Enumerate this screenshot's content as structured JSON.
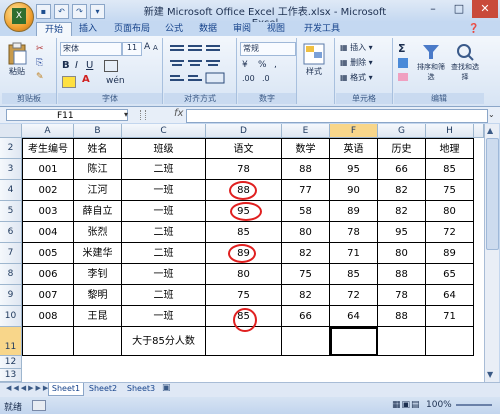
{
  "window": {
    "title": "新建 Microsoft Office Excel 工作表.xlsx - Microsoft Excel"
  },
  "tabs": [
    "开始",
    "插入",
    "页面布局",
    "公式",
    "数据",
    "审阅",
    "视图",
    "开发工具"
  ],
  "ribbon": {
    "clipboard": {
      "paste": "粘贴",
      "label": "剪贴板"
    },
    "font": {
      "name": "宋体",
      "size": "11",
      "label": "字体"
    },
    "alignment": {
      "label": "对齐方式"
    },
    "number": {
      "format": "常规",
      "label": "数字"
    },
    "styles": {
      "label": "样式",
      "button": "样式"
    },
    "cells": {
      "insert": "插入",
      "delete": "删除",
      "format": "格式",
      "label": "单元格"
    },
    "editing": {
      "sum": "Σ",
      "sort": "排序和筛选",
      "find": "查找和选择",
      "label": "编辑"
    }
  },
  "formula_bar": {
    "name_box": "F11",
    "fx": "fx",
    "value": ""
  },
  "columns": [
    "A",
    "B",
    "C",
    "D",
    "E",
    "F",
    "G",
    "H"
  ],
  "rows": [
    "2",
    "3",
    "4",
    "5",
    "6",
    "7",
    "8",
    "9",
    "10",
    "11",
    "12",
    "13"
  ],
  "table": {
    "headers": [
      "考生编号",
      "姓名",
      "班级",
      "语文",
      "数学",
      "英语",
      "历史",
      "地理"
    ],
    "data": [
      [
        "001",
        "陈江",
        "二班",
        "78",
        "88",
        "95",
        "66",
        "85"
      ],
      [
        "002",
        "江河",
        "一班",
        "88",
        "77",
        "90",
        "82",
        "75"
      ],
      [
        "003",
        "薛自立",
        "一班",
        "95",
        "58",
        "89",
        "82",
        "80"
      ],
      [
        "004",
        "张烈",
        "二班",
        "85",
        "80",
        "78",
        "95",
        "72"
      ],
      [
        "005",
        "米建华",
        "二班",
        "89",
        "82",
        "71",
        "80",
        "89"
      ],
      [
        "006",
        "李钊",
        "一班",
        "80",
        "75",
        "85",
        "88",
        "65"
      ],
      [
        "007",
        "黎明",
        "二班",
        "75",
        "82",
        "72",
        "78",
        "64"
      ],
      [
        "008",
        "王昆",
        "一班",
        "85",
        "66",
        "64",
        "88",
        "71"
      ]
    ],
    "summary_label": "大于85分人数"
  },
  "sheets": [
    "Sheet1",
    "Sheet2",
    "Sheet3"
  ],
  "status": {
    "ready": "就绪",
    "zoom": "100%"
  },
  "colors": {
    "annotation": "#e02020",
    "selected_header": "#f8d68a"
  }
}
